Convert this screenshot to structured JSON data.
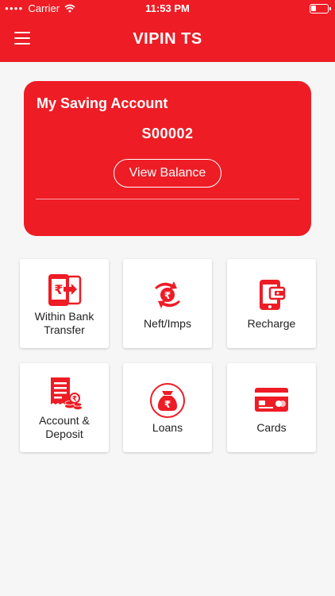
{
  "status_bar": {
    "carrier": "Carrier",
    "time": "11:53 PM"
  },
  "header": {
    "title": "VIPIN TS"
  },
  "account": {
    "title": "My Saving Account",
    "number": "S00002",
    "view_balance_label": "View Balance"
  },
  "tiles": [
    {
      "label": "Within Bank Transfer",
      "icon": "mobile-transfer-icon"
    },
    {
      "label": "Neft/Imps",
      "icon": "rupee-exchange-icon"
    },
    {
      "label": "Recharge",
      "icon": "mobile-wallet-icon"
    },
    {
      "label": "Account & Deposit",
      "icon": "receipt-coins-icon"
    },
    {
      "label": "Loans",
      "icon": "rupee-bag-icon"
    },
    {
      "label": "Cards",
      "icon": "credit-card-icon"
    }
  ],
  "colors": {
    "primary": "#ee1c25",
    "background": "#f6f6f6",
    "tile": "#ffffff"
  }
}
